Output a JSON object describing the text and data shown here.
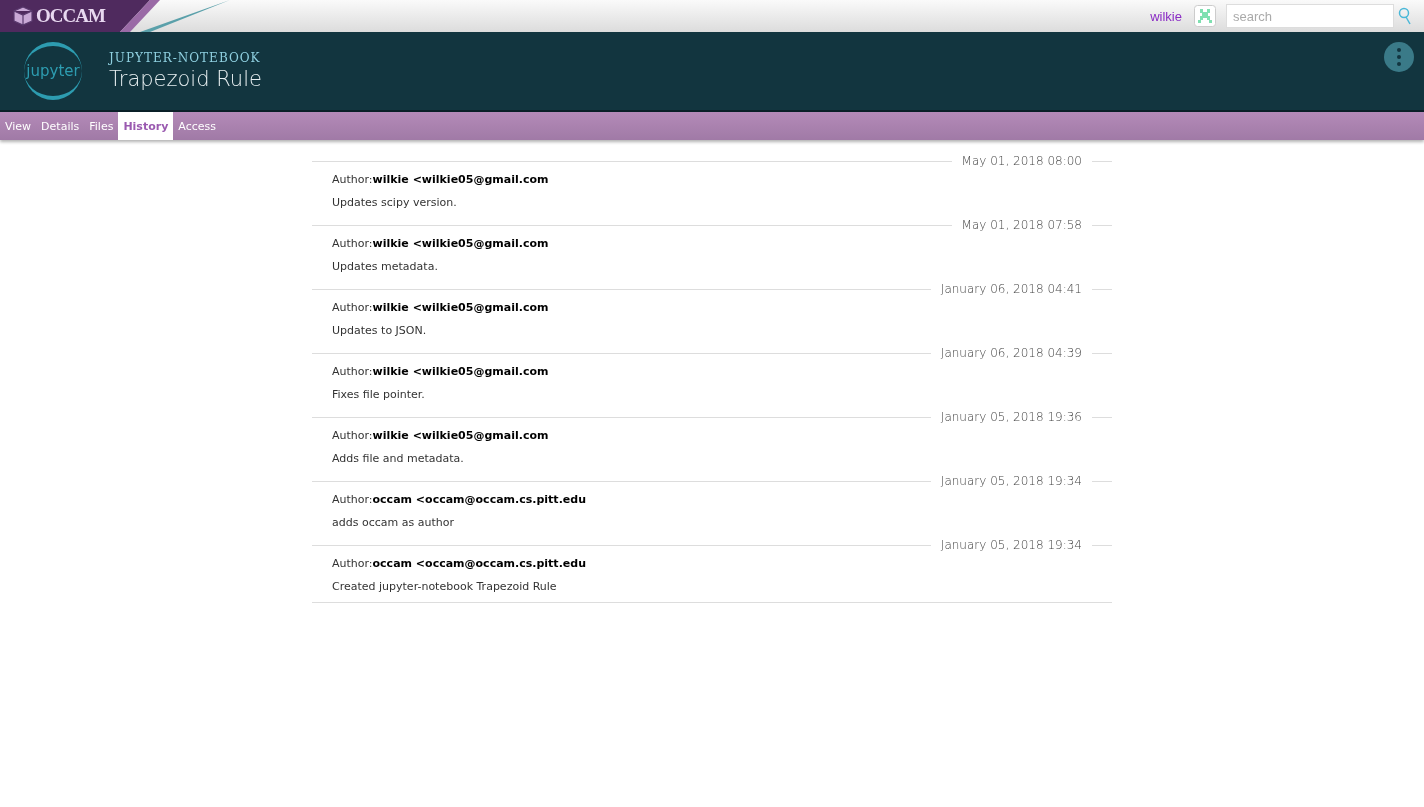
{
  "topbar": {
    "logo": "OCCAM",
    "username": "wilkie",
    "search": {
      "placeholder": "search"
    }
  },
  "header": {
    "logo_text": "jupyter",
    "type": "JUPYTER-NOTEBOOK",
    "title": "Trapezoid Rule"
  },
  "tabs": [
    {
      "label": "View",
      "selected": false
    },
    {
      "label": "Details",
      "selected": false
    },
    {
      "label": "Files",
      "selected": false
    },
    {
      "label": "History",
      "selected": true
    },
    {
      "label": "Access",
      "selected": false
    }
  ],
  "history": [
    {
      "date": "May 01, 2018 08:00",
      "author": "Author:**wilkie <wilkie05@gmail.com**",
      "message": "Updates scipy version."
    },
    {
      "date": "May 01, 2018 07:58",
      "author": "Author:**wilkie <wilkie05@gmail.com**",
      "message": "Updates metadata."
    },
    {
      "date": "January 06, 2018 04:41",
      "author": "Author:**wilkie <wilkie05@gmail.com**",
      "message": "Updates to JSON."
    },
    {
      "date": "January 06, 2018 04:39",
      "author": "Author:**wilkie <wilkie05@gmail.com**",
      "message": "Fixes file pointer."
    },
    {
      "date": "January 05, 2018 19:36",
      "author": "Author:**wilkie <wilkie05@gmail.com**",
      "message": "Adds file and metadata."
    },
    {
      "date": "January 05, 2018 19:34",
      "author": "Author:**occam <occam@occam.cs.pitt.edu**",
      "message": "adds occam as author"
    },
    {
      "date": "January 05, 2018 19:34",
      "author": "Author:**occam <occam@occam.cs.pitt.edu**",
      "message": "Created jupyter-notebook Trapezoid Rule"
    }
  ]
}
